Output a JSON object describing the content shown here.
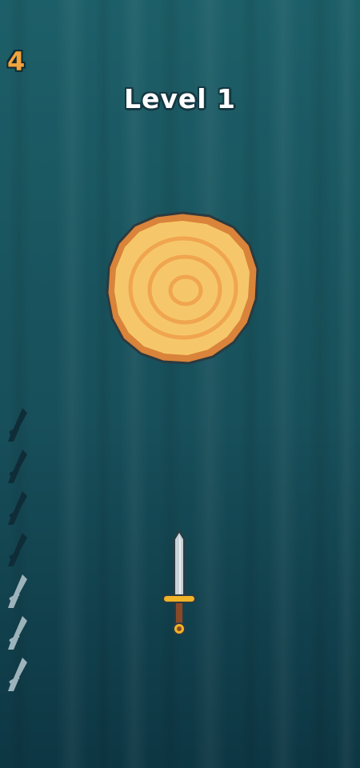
{
  "game": {
    "score": "4",
    "level_label": "Level 1",
    "knives_total": 7,
    "knives_used": 4
  },
  "colors": {
    "background_top": "#1d5d66",
    "background_bottom": "#0d3744",
    "score": "#f2a33c",
    "log_fill": "#f6c76a",
    "log_ring": "#f0a54f",
    "log_rim": "#d9843a",
    "blade": "#c7cfd6",
    "guard": "#f0b429",
    "handle": "#8a4a27",
    "rack_used": "#0f2d38",
    "rack_remaining": "#9db3bb"
  },
  "icons": {
    "target": "wood-log-icon",
    "thrown_knife": "sword-icon",
    "player_knife": "sword-icon",
    "knife_counter": "knife-silhouette-icon"
  }
}
